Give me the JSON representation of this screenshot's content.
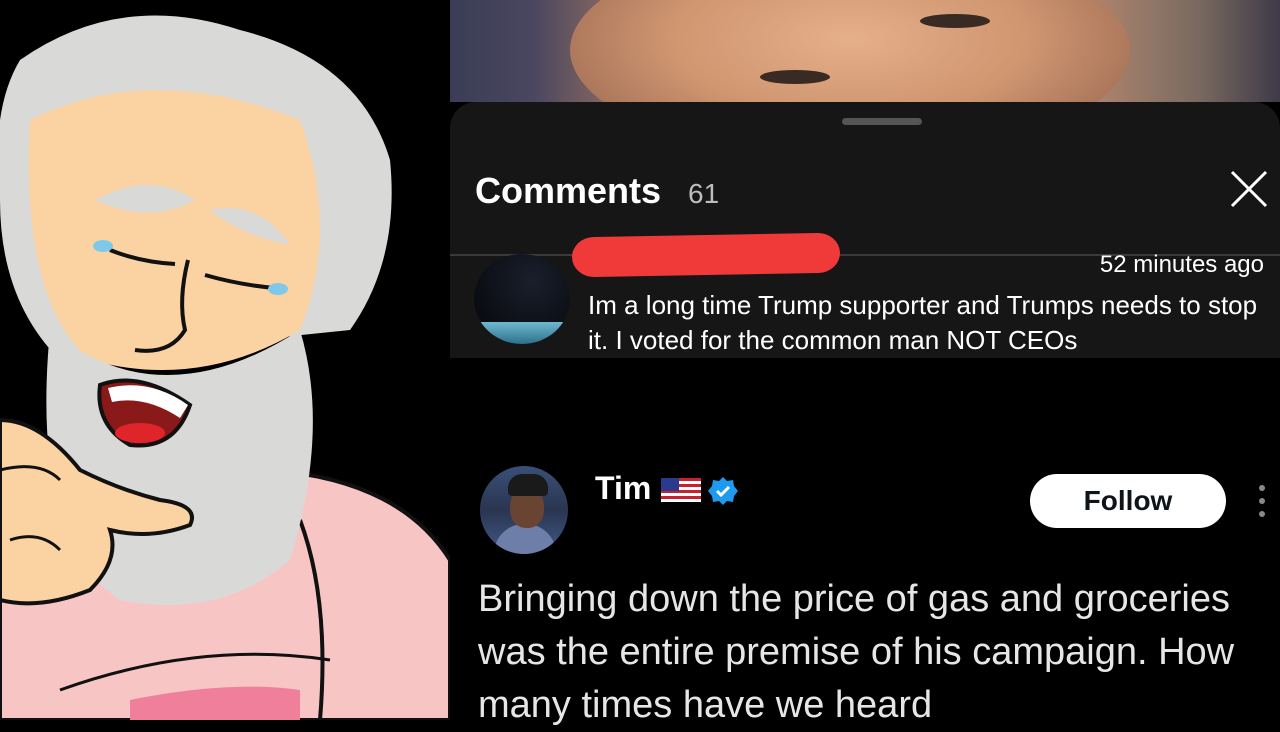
{
  "comments_sheet": {
    "title": "Comments",
    "count": "61",
    "close_icon": "close-icon",
    "comment": {
      "timestamp": "52 minutes ago",
      "text": "Im a long time Trump supporter and Trumps needs to stop it. I voted for the common man NOT CEOs"
    }
  },
  "post": {
    "author": "Tim",
    "flag_icon": "us-flag-icon",
    "verified_icon": "verified-badge-icon",
    "follow_label": "Follow",
    "more_icon": "more-vertical-icon",
    "text": "Bringing down the price of gas and groceries was the entire premise of his campaign. How many times have we heard"
  },
  "colors": {
    "sheet_bg": "#161616",
    "redaction": "#f03a3a",
    "verified": "#1d9bf0",
    "follow_bg": "#ffffff"
  }
}
